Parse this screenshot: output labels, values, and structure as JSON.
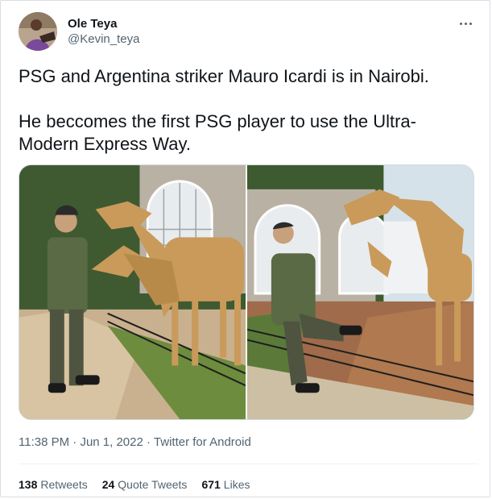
{
  "author": {
    "display_name": "Ole Teya",
    "handle": "@Kevin_teya"
  },
  "tweet": {
    "text": "PSG and Argentina striker Mauro Icardi is in Nairobi.\n\nHe beccomes the first PSG player to use the Ultra-Modern Express Way."
  },
  "meta": {
    "time": "11:38 PM",
    "sep1": "·",
    "date": "Jun 1, 2022",
    "sep2": "·",
    "source": "Twitter for Android"
  },
  "stats": {
    "retweets_count": "138",
    "retweets_label": "Retweets",
    "quotes_count": "24",
    "quotes_label": "Quote Tweets",
    "likes_count": "671",
    "likes_label": "Likes"
  },
  "colors": {
    "text_primary": "#0f1419",
    "text_secondary": "#536471",
    "border": "#cfd9de"
  },
  "icons": {
    "more": "more-horizontal-icon"
  }
}
